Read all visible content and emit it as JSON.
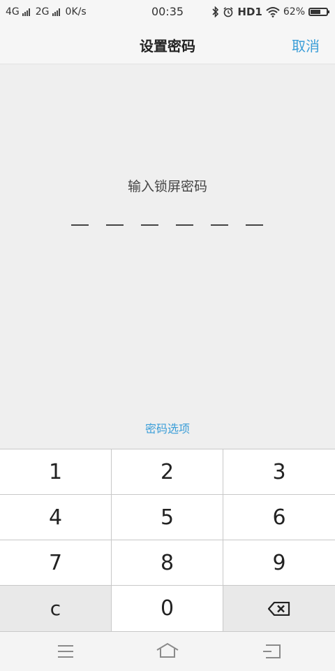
{
  "status_bar": {
    "network_1": "4G",
    "network_2": "2G",
    "speed": "0K/s",
    "time": "00:35",
    "hd": "HD1",
    "battery_text": "62%",
    "battery_level": 0.62
  },
  "header": {
    "title": "设置密码",
    "cancel_label": "取消"
  },
  "main": {
    "prompt": "输入锁屏密码",
    "pin_length": 6,
    "options_label": "密码选项"
  },
  "keypad": {
    "keys": [
      "1",
      "2",
      "3",
      "4",
      "5",
      "6",
      "7",
      "8",
      "9",
      "c",
      "0"
    ],
    "backspace_icon": "backspace-icon"
  },
  "nav_bar": {
    "menu_icon": "menu-icon",
    "home_icon": "home-icon",
    "back_icon": "back-icon"
  },
  "colors": {
    "accent": "#3b9ed8",
    "background": "#efefef",
    "key_background": "#ffffff",
    "key_gray": "#e9e9e9"
  }
}
